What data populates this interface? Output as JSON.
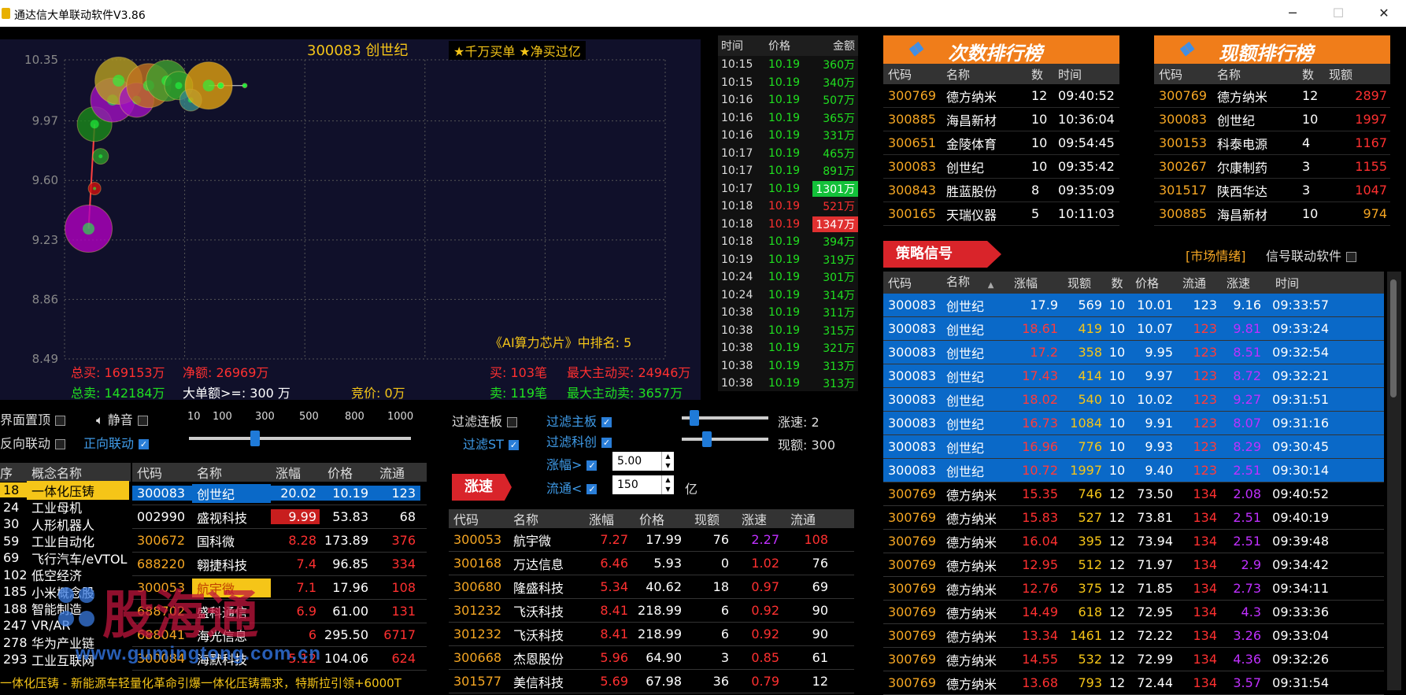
{
  "window": {
    "title": "通达信大单联动软件V3.86",
    "min": "─",
    "max": "☐",
    "close": "✕"
  },
  "chart": {
    "stock": "300083 创世纪",
    "tag": "★千万买单 ★净买过亿",
    "ranking": "《AI算力芯片》中排名: 5",
    "yticks": [
      "10.35",
      "9.97",
      "9.60",
      "9.23",
      "8.86",
      "8.49"
    ],
    "total_buy": "总买: 169153万",
    "net": "净额: 26969万",
    "total_sell": "总卖: 142184万",
    "big_threshold": "大单额>=: 300 万",
    "auction": "竞价: 0万",
    "buy_count": "买: 103笔",
    "sell_count": "卖: 119笔",
    "max_buy": "最大主动买: 24946万",
    "max_sell": "最大主动卖: 3657万"
  },
  "chart_data": {
    "type": "scatter",
    "ylim": [
      8.49,
      10.35
    ],
    "points": [
      {
        "x": 0.04,
        "y": 9.3,
        "size": 30,
        "color": "#b000c0"
      },
      {
        "x": 0.05,
        "y": 9.55,
        "size": 8,
        "color": "#d01010"
      },
      {
        "x": 0.06,
        "y": 9.75,
        "size": 10,
        "color": "#2a9a2a"
      },
      {
        "x": 0.05,
        "y": 9.95,
        "size": 22,
        "color": "#1a8a1a"
      },
      {
        "x": 0.08,
        "y": 10.1,
        "size": 28,
        "color": "#a010c0"
      },
      {
        "x": 0.09,
        "y": 10.22,
        "size": 30,
        "color": "#b8a020"
      },
      {
        "x": 0.12,
        "y": 10.1,
        "size": 22,
        "color": "#a010c0"
      },
      {
        "x": 0.14,
        "y": 10.19,
        "size": 28,
        "color": "#c07020"
      },
      {
        "x": 0.17,
        "y": 10.22,
        "size": 26,
        "color": "#40a030"
      },
      {
        "x": 0.19,
        "y": 10.19,
        "size": 18,
        "color": "#2a9a2a"
      },
      {
        "x": 0.21,
        "y": 10.1,
        "size": 14,
        "color": "#3a8a8a"
      },
      {
        "x": 0.24,
        "y": 10.19,
        "size": 30,
        "color": "#e0a010"
      },
      {
        "x": 0.26,
        "y": 10.19,
        "size": 4,
        "color": "#20ff40"
      },
      {
        "x": 0.3,
        "y": 10.19,
        "size": 3,
        "color": "#20ff40"
      }
    ]
  },
  "trades": {
    "headers": [
      "时间",
      "价格",
      "金额"
    ],
    "rows": [
      [
        "10:15",
        "10.19",
        "360万",
        "g"
      ],
      [
        "10:15",
        "10.19",
        "340万",
        "g"
      ],
      [
        "10:16",
        "10.19",
        "507万",
        "g"
      ],
      [
        "10:16",
        "10.19",
        "365万",
        "g"
      ],
      [
        "10:16",
        "10.19",
        "331万",
        "g"
      ],
      [
        "10:17",
        "10.19",
        "465万",
        "g"
      ],
      [
        "10:17",
        "10.19",
        "891万",
        "g"
      ],
      [
        "10:17",
        "10.19",
        "1301万",
        "G"
      ],
      [
        "10:18",
        "10.19",
        "521万",
        "r"
      ],
      [
        "10:18",
        "10.19",
        "1347万",
        "R"
      ],
      [
        "10:18",
        "10.19",
        "394万",
        "g"
      ],
      [
        "10:19",
        "10.19",
        "319万",
        "g"
      ],
      [
        "10:24",
        "10.19",
        "301万",
        "g"
      ],
      [
        "10:24",
        "10.19",
        "314万",
        "g"
      ],
      [
        "10:38",
        "10.19",
        "311万",
        "g"
      ],
      [
        "10:38",
        "10.19",
        "315万",
        "g"
      ],
      [
        "10:38",
        "10.19",
        "321万",
        "g"
      ],
      [
        "10:38",
        "10.19",
        "313万",
        "g"
      ],
      [
        "10:38",
        "10.19",
        "313万",
        "g"
      ]
    ]
  },
  "rank_count": {
    "title": "次数排行榜",
    "headers": [
      "代码",
      "名称",
      "数",
      "时间"
    ],
    "rows": [
      [
        "300769",
        "德方纳米",
        "12",
        "09:40:52"
      ],
      [
        "300885",
        "海昌新材",
        "10",
        "10:36:04"
      ],
      [
        "300651",
        "金陵体育",
        "10",
        "09:54:45"
      ],
      [
        "300083",
        "创世纪",
        "10",
        "09:35:42"
      ],
      [
        "300843",
        "胜蓝股份",
        "8",
        "09:35:09"
      ],
      [
        "300165",
        "天瑞仪器",
        "5",
        "10:11:03"
      ]
    ]
  },
  "rank_amount": {
    "title": "现额排行榜",
    "headers": [
      "代码",
      "名称",
      "数",
      "现额"
    ],
    "rows": [
      [
        "300769",
        "德方纳米",
        "12",
        "2897"
      ],
      [
        "300083",
        "创世纪",
        "10",
        "1997"
      ],
      [
        "300153",
        "科泰电源",
        "4",
        "1167"
      ],
      [
        "300267",
        "尔康制药",
        "3",
        "1155"
      ],
      [
        "301517",
        "陕西华达",
        "3",
        "1047"
      ],
      [
        "300885",
        "海昌新材",
        "10",
        "974"
      ]
    ]
  },
  "strategy": {
    "tag": "策略信号",
    "market_link": "[市场情绪]",
    "signal_link": "信号联动软件",
    "headers": [
      "代码",
      "名称",
      "涨幅",
      "现额",
      "数",
      "价格",
      "流通",
      "涨速",
      "时间"
    ],
    "sort_arrow": "▲",
    "rows": [
      [
        "300083",
        "创世纪",
        "17.9",
        "569",
        "10",
        "10.01",
        "123",
        "9.16",
        "09:33:57",
        1
      ],
      [
        "300083",
        "创世纪",
        "18.61",
        "419",
        "10",
        "10.07",
        "123",
        "9.81",
        "09:33:24",
        1
      ],
      [
        "300083",
        "创世纪",
        "17.2",
        "358",
        "10",
        "9.95",
        "123",
        "8.51",
        "09:32:54",
        1
      ],
      [
        "300083",
        "创世纪",
        "17.43",
        "414",
        "10",
        "9.97",
        "123",
        "8.72",
        "09:32:21",
        1
      ],
      [
        "300083",
        "创世纪",
        "18.02",
        "540",
        "10",
        "10.02",
        "123",
        "9.27",
        "09:31:51",
        1
      ],
      [
        "300083",
        "创世纪",
        "16.73",
        "1084",
        "10",
        "9.91",
        "123",
        "8.07",
        "09:31:16",
        1
      ],
      [
        "300083",
        "创世纪",
        "16.96",
        "776",
        "10",
        "9.93",
        "123",
        "8.29",
        "09:30:45",
        1
      ],
      [
        "300083",
        "创世纪",
        "10.72",
        "1997",
        "10",
        "9.40",
        "123",
        "2.51",
        "09:30:14",
        1
      ],
      [
        "300769",
        "德方纳米",
        "15.35",
        "746",
        "12",
        "73.50",
        "134",
        "2.08",
        "09:40:52",
        0
      ],
      [
        "300769",
        "德方纳米",
        "15.83",
        "527",
        "12",
        "73.81",
        "134",
        "2.51",
        "09:40:19",
        0
      ],
      [
        "300769",
        "德方纳米",
        "16.04",
        "395",
        "12",
        "73.94",
        "134",
        "2.51",
        "09:39:48",
        0
      ],
      [
        "300769",
        "德方纳米",
        "12.95",
        "512",
        "12",
        "71.97",
        "134",
        "2.9",
        "09:34:42",
        0
      ],
      [
        "300769",
        "德方纳米",
        "12.76",
        "375",
        "12",
        "71.85",
        "134",
        "2.73",
        "09:34:11",
        0
      ],
      [
        "300769",
        "德方纳米",
        "14.49",
        "618",
        "12",
        "72.95",
        "134",
        "4.3",
        "09:33:36",
        0
      ],
      [
        "300769",
        "德方纳米",
        "13.34",
        "1461",
        "12",
        "72.22",
        "134",
        "3.26",
        "09:33:04",
        0
      ],
      [
        "300769",
        "德方纳米",
        "14.55",
        "532",
        "12",
        "72.99",
        "134",
        "4.36",
        "09:32:26",
        0
      ],
      [
        "300769",
        "德方纳米",
        "13.68",
        "793",
        "12",
        "72.44",
        "134",
        "3.57",
        "09:31:54",
        0
      ]
    ]
  },
  "controls": {
    "pin": "界面置顶",
    "mute": "静音",
    "reverse": "反向联动",
    "forward": "正向联动",
    "scale": [
      "10",
      "100",
      "300",
      "500",
      "800",
      "1000"
    ],
    "f_lianban": "过滤连板",
    "f_main": "过滤主板",
    "f_st": "过滤ST",
    "f_kc": "过滤科创",
    "speed_label": "涨速: 2",
    "amount_label": "现额: 300",
    "zf_label": "涨幅>",
    "zf_value": "5.00",
    "lt_label": "流通<",
    "lt_value": "150",
    "unit": "亿",
    "speed_tag": "涨速"
  },
  "concept": {
    "headers": [
      "序",
      "概念名称"
    ],
    "rows": [
      [
        "18",
        "一体化压铸"
      ],
      [
        "24",
        "工业母机"
      ],
      [
        "30",
        "人形机器人"
      ],
      [
        "59",
        "工业自动化"
      ],
      [
        "69",
        "飞行汽车/eVTOL"
      ],
      [
        "102",
        "低空经济"
      ],
      [
        "185",
        "小米概念股"
      ],
      [
        "188",
        "智能制造"
      ],
      [
        "247",
        "VR/AR"
      ],
      [
        "278",
        "华为产业链"
      ],
      [
        "293",
        "工业互联网"
      ]
    ]
  },
  "stocks": {
    "headers": [
      "代码",
      "名称",
      "涨幅",
      "价格",
      "流通"
    ],
    "rows": [
      [
        "300083",
        "创世纪",
        "20.02",
        "10.19",
        "123"
      ],
      [
        "002990",
        "盛视科技",
        "9.99",
        "53.83",
        "68"
      ],
      [
        "300672",
        "国科微",
        "8.28",
        "173.89",
        "376"
      ],
      [
        "688220",
        "翱捷科技",
        "7.4",
        "96.85",
        "334"
      ],
      [
        "300053",
        "航宇微",
        "7.1",
        "17.96",
        "108"
      ],
      [
        "688702",
        "盛科通信",
        "6.9",
        "61.00",
        "131"
      ],
      [
        "688041",
        "海光信息",
        "6",
        "295.50",
        "6717"
      ],
      [
        "300084",
        "海默科技",
        "5.12",
        "104.06",
        "624"
      ]
    ]
  },
  "speed": {
    "headers": [
      "代码",
      "名称",
      "涨幅",
      "价格",
      "现额",
      "涨速",
      "流通"
    ],
    "rows": [
      [
        "300053",
        "航宇微",
        "7.27",
        "17.99",
        "76",
        "2.27",
        "108"
      ],
      [
        "300168",
        "万达信息",
        "6.46",
        "5.93",
        "0",
        "1.02",
        "76"
      ],
      [
        "300680",
        "隆盛科技",
        "5.34",
        "40.62",
        "18",
        "0.97",
        "69"
      ],
      [
        "301232",
        "飞沃科技",
        "8.41",
        "218.99",
        "6",
        "0.92",
        "90"
      ],
      [
        "301232",
        "飞沃科技",
        "8.41",
        "218.99",
        "6",
        "0.92",
        "90"
      ],
      [
        "300668",
        "杰恩股份",
        "5.96",
        "64.90",
        "3",
        "0.85",
        "61"
      ],
      [
        "301577",
        "美信科技",
        "5.69",
        "67.98",
        "36",
        "0.79",
        "12"
      ]
    ]
  },
  "ticker": "一体化压铸 - 新能源车轻量化革命引爆一体化压铸需求，特斯拉引领+6000T",
  "watermark": {
    "cn": "股海通",
    "url": "www.gumingtong.com.cn"
  }
}
